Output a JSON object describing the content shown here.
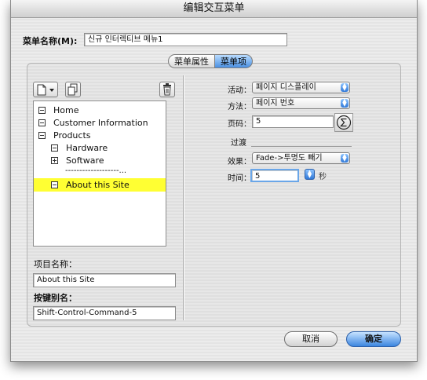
{
  "window": {
    "title": "编辑交互菜单"
  },
  "menu_name": {
    "label": "菜单名称(M):",
    "value": "신규 인터렉티브 메뉴1"
  },
  "tabs": [
    {
      "label": "菜单属性",
      "active": false
    },
    {
      "label": "菜单项",
      "active": true
    }
  ],
  "toolbar": {
    "new_icon": "document-icon",
    "dropdown_icon": "chevron-down-icon",
    "duplicate_icon": "duplicate-icon",
    "delete_icon": "trash-icon"
  },
  "tree": {
    "items": [
      {
        "label": "Home",
        "level": 0,
        "expander": "minus"
      },
      {
        "label": "Customer Information",
        "level": 0,
        "expander": "minus"
      },
      {
        "label": "Products",
        "level": 0,
        "expander": "minus"
      },
      {
        "label": "Hardware",
        "level": 1,
        "expander": "minus"
      },
      {
        "label": "Software",
        "level": 1,
        "expander": "plus"
      },
      {
        "label": "-------------------...",
        "level": 2,
        "expander": "none"
      },
      {
        "label": "About this Site",
        "level": 1,
        "expander": "minus",
        "selected": true
      }
    ],
    "selection_color": "#ffff33"
  },
  "item_name": {
    "label": "项目名称：",
    "value": "About this Site"
  },
  "shortcut": {
    "label": "按键别名：",
    "value": "Shift-Control-Command-5"
  },
  "right": {
    "action": {
      "label": "活动：",
      "value": "페이지 디스플레이"
    },
    "method": {
      "label": "方法：",
      "value": "페이지 번호"
    },
    "page_number": {
      "label": "页码：",
      "value": "5",
      "icon": "sigma-icon"
    },
    "transition_heading": "过渡",
    "effect": {
      "label": "效果：",
      "value": "Fade->투명도 빼기"
    },
    "time": {
      "label": "时间：",
      "value": "5",
      "unit": "秒"
    }
  },
  "buttons": {
    "cancel": "取消",
    "ok": "确定"
  }
}
